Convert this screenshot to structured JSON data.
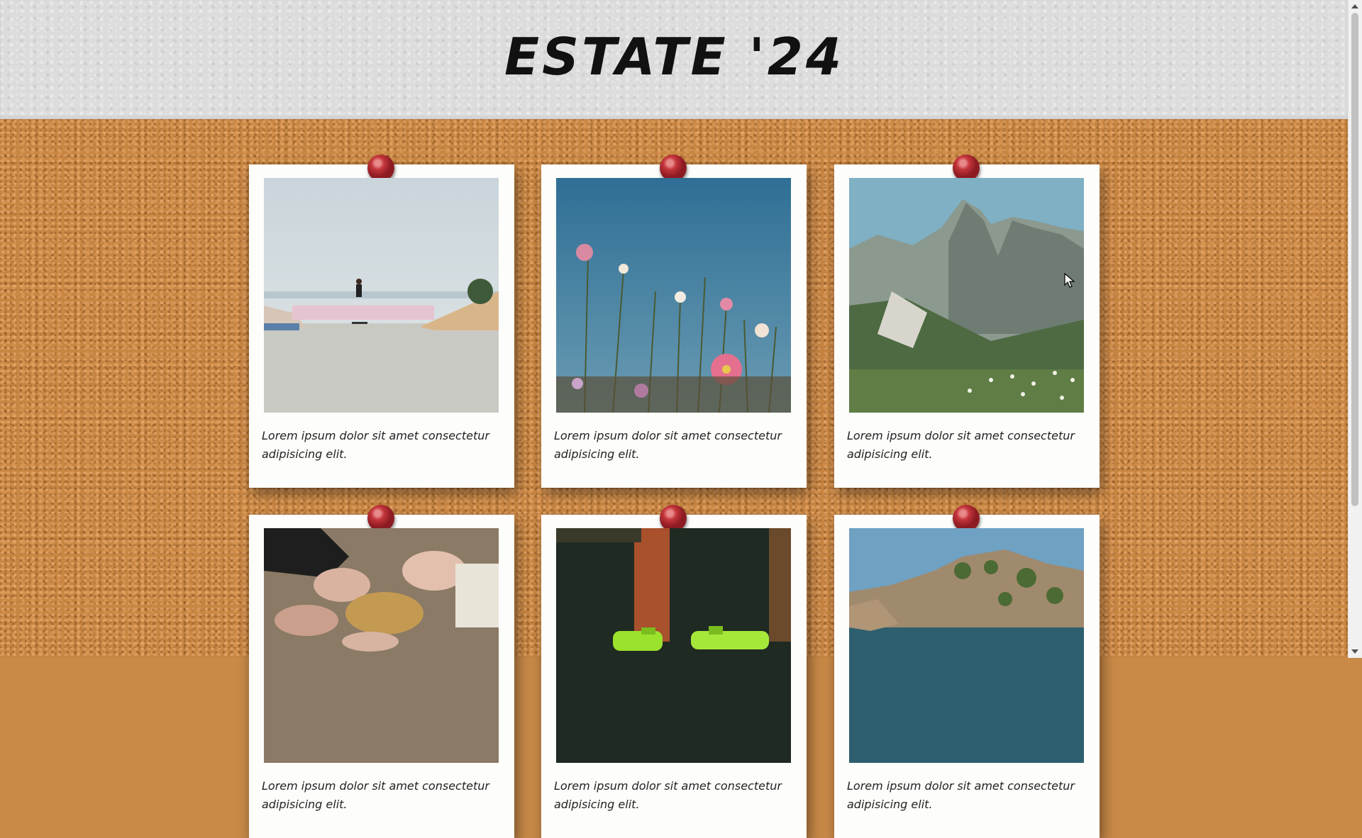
{
  "page": {
    "title": "ESTATE '24"
  },
  "cards": [
    {
      "caption": "Lorem ipsum dolor sit amet consectetur adipisicing elit.",
      "photo": "skatepark-photo"
    },
    {
      "caption": "Lorem ipsum dolor sit amet consectetur adipisicing elit.",
      "photo": "wildflowers-photo"
    },
    {
      "caption": "Lorem ipsum dolor sit amet consectetur adipisicing elit.",
      "photo": "mountains-photo"
    },
    {
      "caption": "Lorem ipsum dolor sit amet consectetur adipisicing elit.",
      "photo": "hands-food-photo"
    },
    {
      "caption": "Lorem ipsum dolor sit amet consectetur adipisicing elit.",
      "photo": "water-guns-photo"
    },
    {
      "caption": "Lorem ipsum dolor sit amet consectetur adipisicing elit.",
      "photo": "coastline-photo"
    }
  ],
  "colors": {
    "cork": "#c88643",
    "header": "#dcdcdc",
    "pin": "#c4353b",
    "card": "#fdfdfb"
  },
  "icons": {
    "pin": "pushpin-icon",
    "cursor": "mouse-pointer-icon"
  }
}
